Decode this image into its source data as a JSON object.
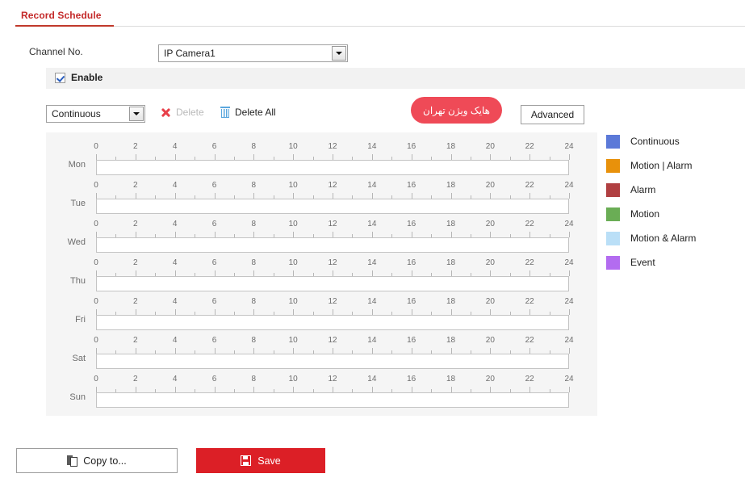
{
  "tab": {
    "active_label": "Record Schedule"
  },
  "channel": {
    "label": "Channel No.",
    "selected": "IP Camera1",
    "icon": "chevron-down-icon"
  },
  "enable": {
    "label": "Enable",
    "checked": true
  },
  "toolbar": {
    "type_selected": "Continuous",
    "delete_label": "Delete",
    "delete_all_label": "Delete All",
    "advanced_label": "Advanced",
    "delete_icon": "close-x-icon",
    "delete_all_icon": "trash-icon"
  },
  "badge": {
    "text": "هایک ویژن تهران",
    "color": "#ef4a57"
  },
  "schedule": {
    "days": [
      "Mon",
      "Tue",
      "Wed",
      "Thu",
      "Fri",
      "Sat",
      "Sun"
    ],
    "tick_labels": [
      "0",
      "2",
      "4",
      "6",
      "8",
      "10",
      "12",
      "14",
      "16",
      "18",
      "20",
      "22",
      "24"
    ],
    "hours_min": 0,
    "hours_max": 24
  },
  "legend": {
    "items": [
      {
        "label": "Continuous",
        "color": "#5b79d8"
      },
      {
        "label": "Motion | Alarm",
        "color": "#e8910b"
      },
      {
        "label": "Alarm",
        "color": "#b03f41"
      },
      {
        "label": "Motion",
        "color": "#6aad55"
      },
      {
        "label": "Motion & Alarm",
        "color": "#badff7"
      },
      {
        "label": "Event",
        "color": "#b36cf0"
      }
    ]
  },
  "footer": {
    "copy_to_label": "Copy to...",
    "save_label": "Save",
    "copy_icon": "copy-icon",
    "save_icon": "floppy-disk-icon",
    "save_color": "#dc1f26"
  }
}
